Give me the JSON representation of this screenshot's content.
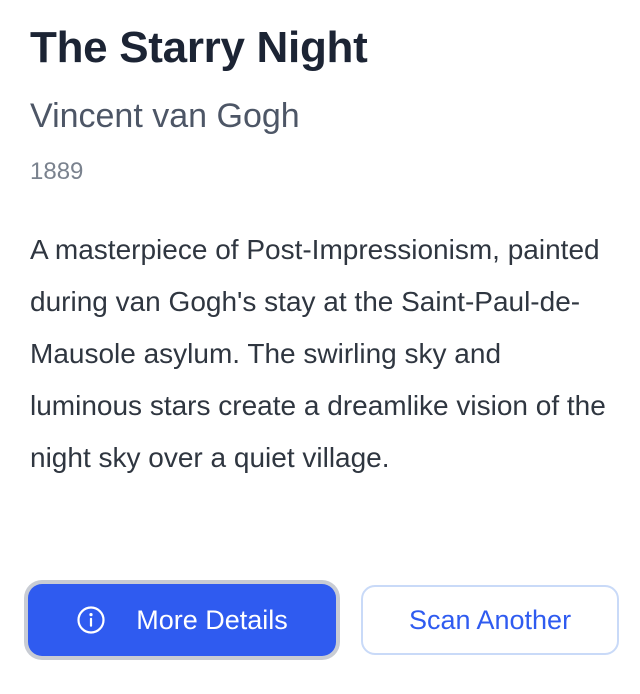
{
  "artwork": {
    "title": "The Starry Night",
    "artist": "Vincent van Gogh",
    "year": "1889",
    "description": "A masterpiece of Post-Impressionism, painted during van Gogh's stay at the Saint-Paul-de-Mausole asylum. The swirling sky and luminous stars create a dreamlike vision of the night sky over a quiet village."
  },
  "actions": {
    "more_details_label": "More Details",
    "more_details_icon": "info-icon",
    "scan_another_label": "Scan Another"
  },
  "colors": {
    "primary": "#2f5bf0",
    "title_text": "#1c2434",
    "secondary_border": "#c9daf8"
  }
}
